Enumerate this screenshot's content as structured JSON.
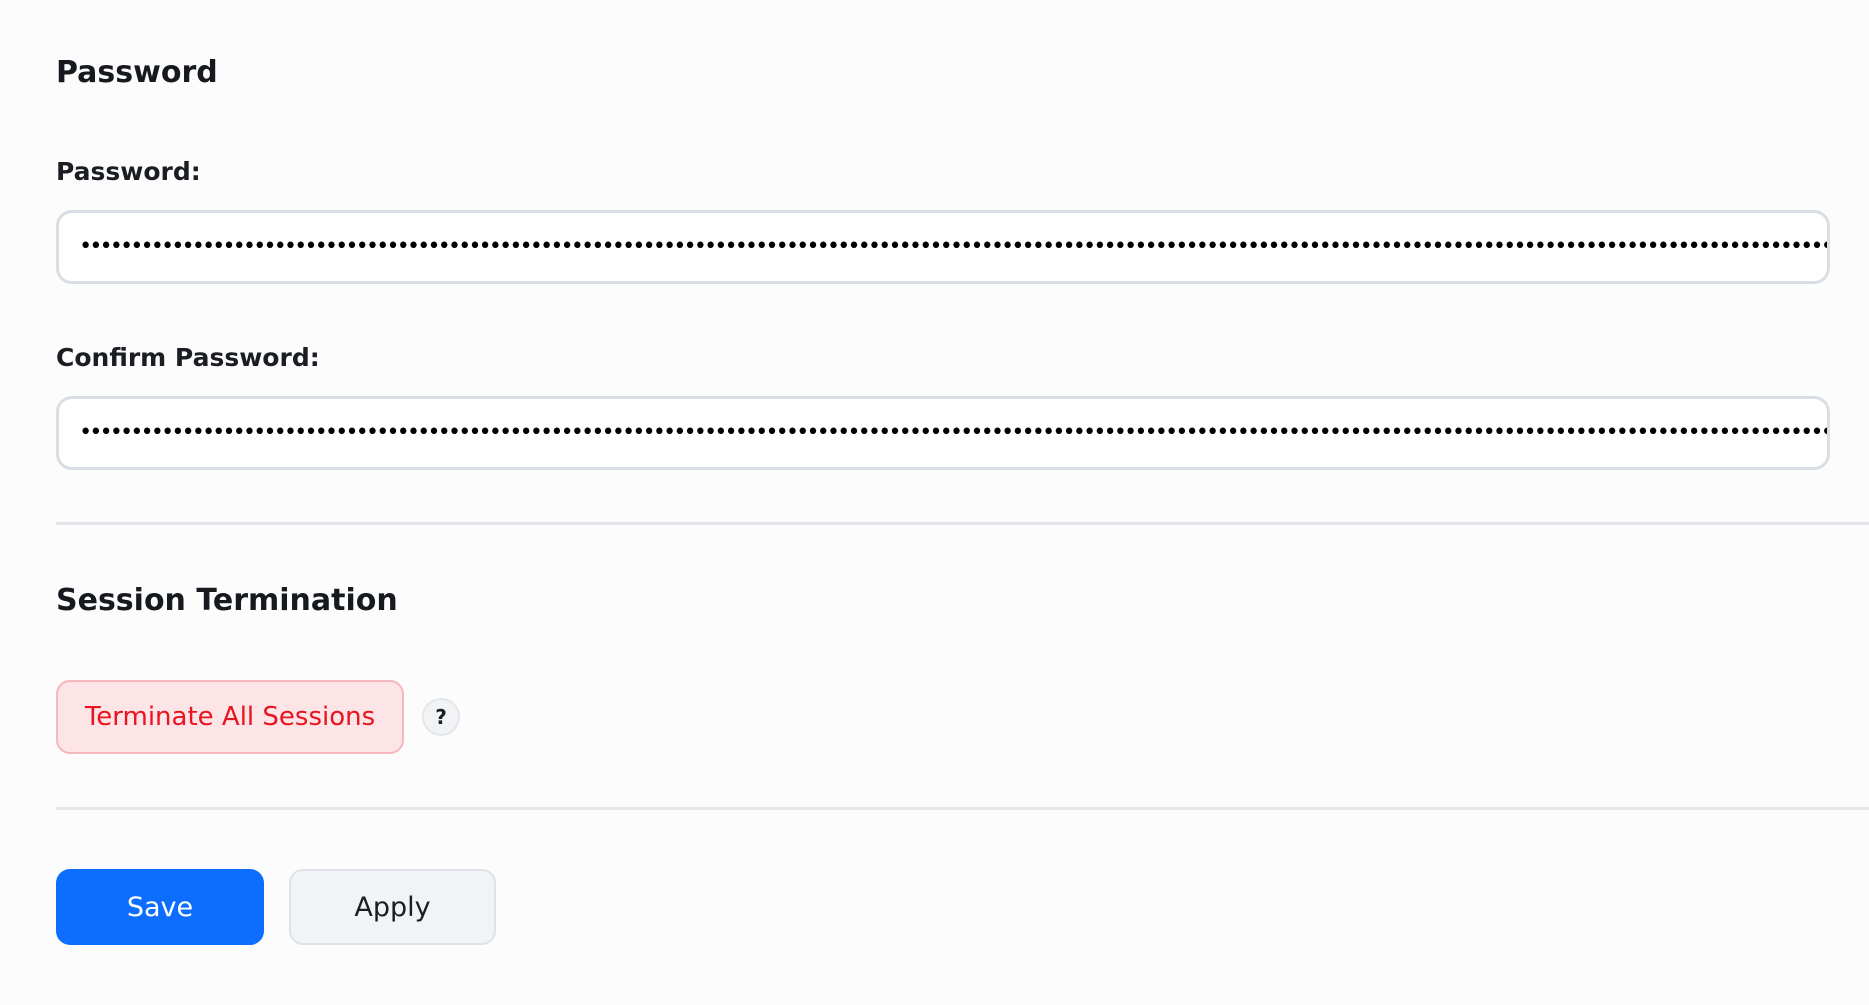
{
  "password_section": {
    "title": "Password",
    "password_label": "Password:",
    "password_value": "••••••••••••••••••••••••••••••••••••••••••••••••••••••••••••••••••••••••••••••••••••••••••••••••••••••••••••••••••••••••••••••••••••••••••••••••••••••••••••••••••••••••••••••••••••••••••••••••••••••••••••••",
    "confirm_label": "Confirm Password:",
    "confirm_value": "••••••••••••••••••••••••••••••••••••••••••••••••••••••••••••••••••••••••••••••••••••••••••••••••••••••••••••••••••••••••••••••••••••••••••••••••••••••••••••••••••••••••••••••••••••••••••••••••••••••••••••••"
  },
  "session_section": {
    "title": "Session Termination",
    "terminate_label": "Terminate All Sessions",
    "help_icon": "question-mark-icon",
    "help_glyph": "?"
  },
  "actions": {
    "save_label": "Save",
    "apply_label": "Apply"
  },
  "colors": {
    "primary": "#0d6efd",
    "danger_text": "#e8141f",
    "danger_bg": "#fde4e6"
  }
}
